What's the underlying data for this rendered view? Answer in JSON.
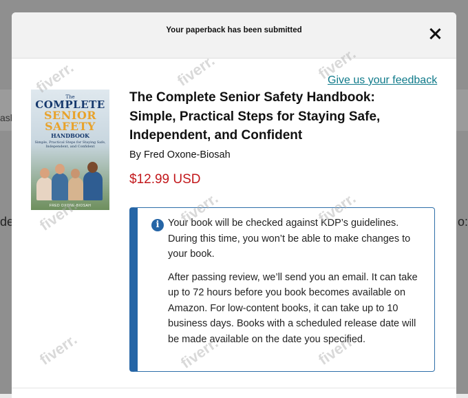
{
  "background": {
    "left_fragment_1": "ash",
    "left_fragment_2": "de",
    "right_fragment": "o:"
  },
  "modal": {
    "title": "Your paperback has been submitted",
    "close_icon": "close-icon",
    "feedback_link": "Give us your feedback"
  },
  "book": {
    "title": "The Complete Senior Safety Handbook: Simple, Practical Steps for Staying Safe, Independent, and Confident",
    "author": "By Fred Oxone-Biosah",
    "price": "$12.99 USD",
    "price_color": "#c2171b",
    "cover": {
      "line1": "The",
      "line2": "COMPLETE",
      "line3": "SENIOR",
      "line4": "SAFETY",
      "line5": "HANDBOOK",
      "subtitle": "Simple, Practical Steps for Staying Safe, Independent, and Confident",
      "author": "FRED OXONE-BIOSAH"
    }
  },
  "notice": {
    "icon": "info-icon",
    "accent_color": "#2565a6",
    "paragraph1": "Your book will be checked against KDP’s guidelines. During this time, you won’t be able to make changes to your book.",
    "paragraph2": "After passing review, we’ll send you an email. It can take up to 72 hours before you book becomes available on Amazon. For low-content books, it can take up to 10 business days. Books with a scheduled release date will be made available on the date you specified."
  },
  "watermark": {
    "text": "fiverr."
  }
}
